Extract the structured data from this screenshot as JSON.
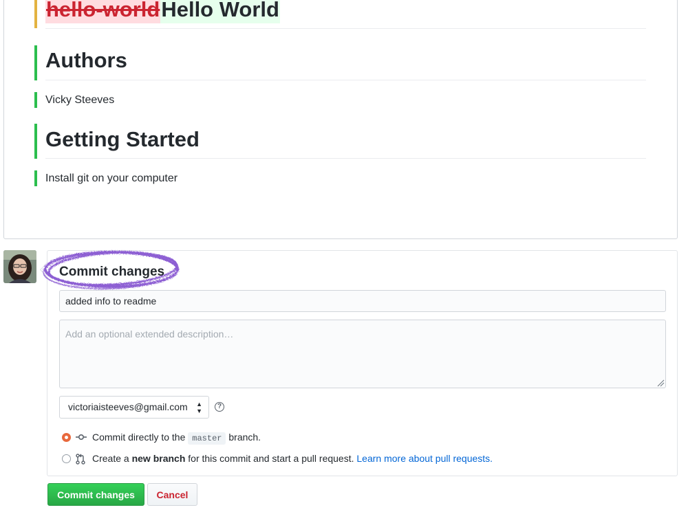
{
  "preview": {
    "heading_deleted": "hello-world",
    "heading_inserted": "Hello World",
    "authors_heading": "Authors",
    "authors_text": "Vicky Steeves",
    "getting_started_heading": "Getting Started",
    "getting_started_text": "Install git on your computer"
  },
  "commit": {
    "title": "Commit changes",
    "summary_value": "added info to readme",
    "description_placeholder": "Add an optional extended description…",
    "email_selected": "victoriaisteeves@gmail.com",
    "help_symbol": "?",
    "option_direct": {
      "before": "Commit directly to the",
      "branch": "master",
      "after": "branch."
    },
    "option_new_branch": {
      "before": "Create a",
      "bold": "new branch",
      "after": "for this commit and start a pull request.",
      "link": "Learn more about pull requests."
    },
    "commit_button": "Commit changes",
    "cancel_button": "Cancel"
  },
  "colors": {
    "deleted_bg": "#ffdce0",
    "deleted_text": "#cb2431",
    "inserted_bg": "#e6ffed",
    "changed_bar": "#e3b341",
    "added_bar": "#2cbe4e",
    "primary_button": "#28a745",
    "link": "#0366d6",
    "highlight": "#8d5fd3"
  },
  "icons": [
    "git-commit-icon",
    "git-pull-request-icon",
    "help-icon",
    "select-caret-icon",
    "resize-grip-icon"
  ]
}
